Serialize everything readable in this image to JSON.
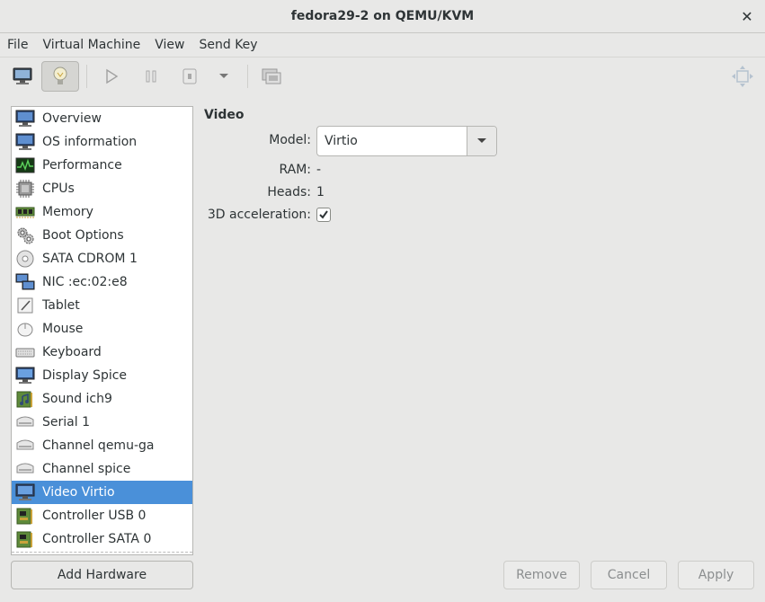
{
  "window": {
    "title": "fedora29-2 on QEMU/KVM",
    "close_glyph": "✕"
  },
  "menubar": [
    "File",
    "Virtual Machine",
    "View",
    "Send Key"
  ],
  "toolbar": {
    "buttons": [
      "console-icon",
      "details-lightbulb-icon",
      "run-icon",
      "pause-icon",
      "shutdown-icon",
      "shutdown-menu-chevron-icon",
      "snapshots-icon",
      "fullscreen-icon"
    ]
  },
  "sidebar": {
    "items": [
      {
        "label": "Overview",
        "icon": "monitor-icon"
      },
      {
        "label": "OS information",
        "icon": "monitor-icon"
      },
      {
        "label": "Performance",
        "icon": "performance-chart-icon"
      },
      {
        "label": "CPUs",
        "icon": "cpu-chip-icon"
      },
      {
        "label": "Memory",
        "icon": "memory-module-icon"
      },
      {
        "label": "Boot Options",
        "icon": "gears-icon"
      },
      {
        "label": "SATA CDROM 1",
        "icon": "cdrom-disc-icon"
      },
      {
        "label": "NIC :ec:02:e8",
        "icon": "network-card-icon"
      },
      {
        "label": "Tablet",
        "icon": "tablet-icon"
      },
      {
        "label": "Mouse",
        "icon": "mouse-icon"
      },
      {
        "label": "Keyboard",
        "icon": "keyboard-icon"
      },
      {
        "label": "Display Spice",
        "icon": "display-monitor-icon"
      },
      {
        "label": "Sound ich9",
        "icon": "sound-card-icon"
      },
      {
        "label": "Serial 1",
        "icon": "serial-port-icon"
      },
      {
        "label": "Channel qemu-ga",
        "icon": "channel-icon"
      },
      {
        "label": "Channel spice",
        "icon": "channel-icon"
      },
      {
        "label": "Video Virtio",
        "icon": "video-card-icon"
      },
      {
        "label": "Controller USB 0",
        "icon": "controller-card-icon"
      },
      {
        "label": "Controller SATA 0",
        "icon": "controller-card-icon"
      }
    ],
    "selected_index": 16,
    "add_hardware_label": "Add Hardware"
  },
  "details": {
    "heading": "Video",
    "model_label": "Model:",
    "model_value": "Virtio",
    "ram_label": "RAM:",
    "ram_value": "-",
    "heads_label": "Heads:",
    "heads_value": "1",
    "accel_label": "3D acceleration:",
    "accel_checked": true
  },
  "actions": {
    "remove": "Remove",
    "cancel": "Cancel",
    "apply": "Apply"
  },
  "colors": {
    "selection": "#4a90d9",
    "window_bg": "#e8e8e7"
  }
}
